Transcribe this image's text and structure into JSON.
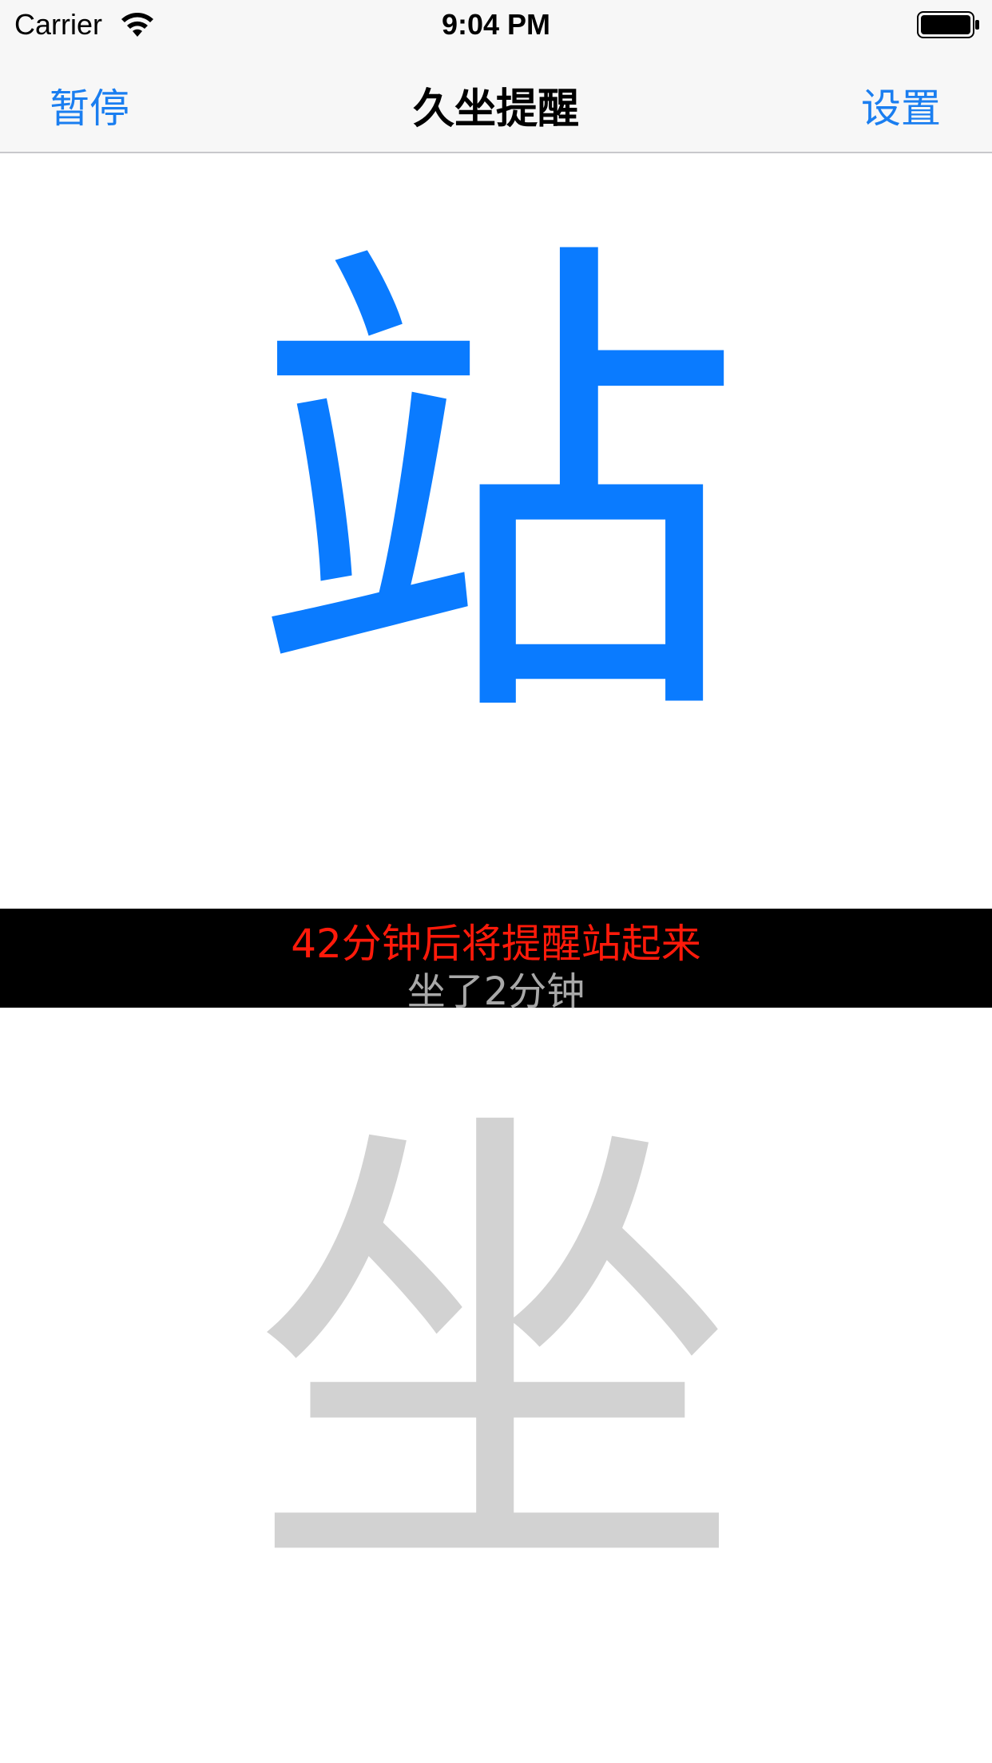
{
  "status_bar": {
    "carrier": "Carrier",
    "time": "9:04 PM",
    "wifi_icon": "wifi-icon",
    "battery_icon": "battery-icon"
  },
  "nav": {
    "left_button": "暂停",
    "title": "久坐提醒",
    "right_button": "设置"
  },
  "main": {
    "stand_char": "站",
    "remind_text": "42分钟后将提醒站起来",
    "sat_text": "坐了2分钟",
    "sit_char": "坐"
  },
  "colors": {
    "accent": "#1a7ef0",
    "stand": "#0a7bff",
    "sit": "#d2d2d2",
    "remind": "#ff1a0a",
    "band": "#000000"
  }
}
